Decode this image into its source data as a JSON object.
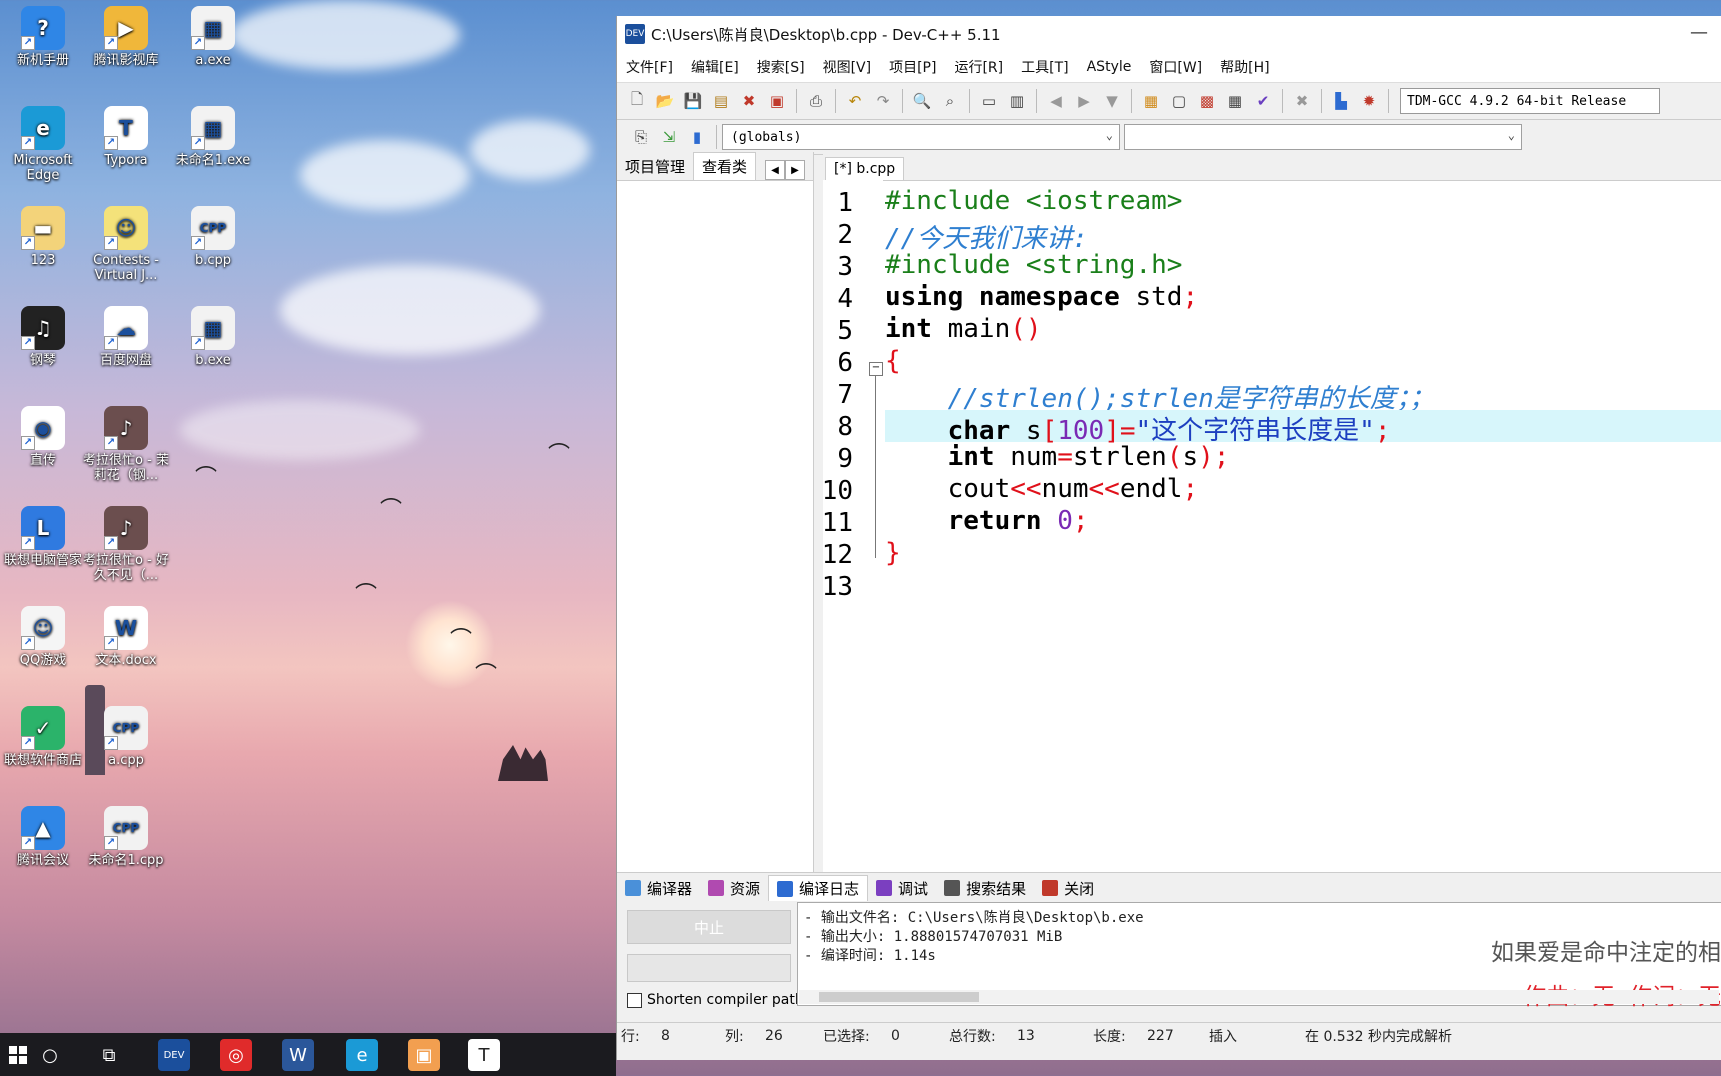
{
  "desktop": {
    "icons": [
      {
        "label": "新机手册",
        "color": "#2f86e6",
        "glyph": "?"
      },
      {
        "label": "腾讯影视库",
        "color": "#f0b73a",
        "glyph": "▶"
      },
      {
        "label": "a.exe",
        "color": "#f2f2f2",
        "glyph": "▦"
      },
      {
        "label": "Microsoft Edge",
        "color": "#1b9ad6",
        "glyph": "e"
      },
      {
        "label": "Typora",
        "color": "#ffffff",
        "glyph": "T"
      },
      {
        "label": "未命名1.exe",
        "color": "#f2f2f2",
        "glyph": "▦"
      },
      {
        "label": "123",
        "color": "#f3d37a",
        "glyph": "▬"
      },
      {
        "label": "Contests - Virtual J...",
        "color": "#f4e27a",
        "glyph": "☺"
      },
      {
        "label": "b.cpp",
        "color": "#f2f2f2",
        "glyph": "CPP"
      },
      {
        "label": "钢琴",
        "color": "#222222",
        "glyph": "♫"
      },
      {
        "label": "百度网盘",
        "color": "#ffffff",
        "glyph": "☁"
      },
      {
        "label": "b.exe",
        "color": "#f2f2f2",
        "glyph": "▦"
      },
      {
        "label": "直传",
        "color": "#ffffff",
        "glyph": "◉"
      },
      {
        "label": "考拉很忙o - 茉莉花（钢...",
        "color": "#6b4e4e",
        "glyph": "♪"
      },
      {
        "label": "联想电脑管家",
        "color": "#2f7ae0",
        "glyph": "L"
      },
      {
        "label": "考拉很忙o - 好久不见（...",
        "color": "#6b4e4e",
        "glyph": "♪"
      },
      {
        "label": "QQ游戏",
        "color": "#f5f5f5",
        "glyph": "☺"
      },
      {
        "label": "文本.docx",
        "color": "#ffffff",
        "glyph": "W"
      },
      {
        "label": "联想软件商店",
        "color": "#2bb36a",
        "glyph": "✓"
      },
      {
        "label": "a.cpp",
        "color": "#f2f2f2",
        "glyph": "CPP"
      },
      {
        "label": "腾讯会议",
        "color": "#2f86e6",
        "glyph": "▲"
      },
      {
        "label": "未命名1.cpp",
        "color": "#f2f2f2",
        "glyph": "CPP"
      }
    ]
  },
  "taskbar": {
    "items": [
      {
        "name": "search-icon",
        "glyph": "○",
        "bg": "transparent"
      },
      {
        "name": "task-view-icon",
        "glyph": "⧉",
        "bg": "transparent"
      },
      {
        "name": "devcpp-taskbar-icon",
        "glyph": "DEV",
        "bg": "#1b4f9c"
      },
      {
        "name": "netease-music-icon",
        "glyph": "◎",
        "bg": "#e02b2b"
      },
      {
        "name": "word-taskbar-icon",
        "glyph": "W",
        "bg": "#2b579a"
      },
      {
        "name": "edge-taskbar-icon",
        "glyph": "e",
        "bg": "#1b9ad6"
      },
      {
        "name": "photos-taskbar-icon",
        "glyph": "▣",
        "bg": "#f29f50"
      },
      {
        "name": "typora-taskbar-icon",
        "glyph": "T",
        "bg": "#ffffff"
      }
    ]
  },
  "window": {
    "title": "C:\\Users\\陈肖良\\Desktop\\b.cpp - Dev-C++ 5.11",
    "app_icon": "DEV",
    "minimize": "—",
    "menu": [
      "文件[F]",
      "编辑[E]",
      "搜索[S]",
      "视图[V]",
      "项目[P]",
      "运行[R]",
      "工具[T]",
      "AStyle",
      "窗口[W]",
      "帮助[H]"
    ],
    "compiler": "TDM-GCC 4.9.2 64-bit Release",
    "scope": "(globals)",
    "scope2": "",
    "left_tabs": [
      "项目管理",
      "查看类"
    ],
    "nav_left": "◀",
    "nav_right": "▶",
    "editor_tab": "[*] b.cpp",
    "fold_marker": "−"
  },
  "code": {
    "current_line": 8,
    "lines": [
      [
        {
          "c": "pp",
          "t": "#include <iostream>"
        }
      ],
      [
        {
          "c": "cm",
          "t": "//今天我们来讲:"
        }
      ],
      [
        {
          "c": "pp",
          "t": "#include <string.h>"
        }
      ],
      [
        {
          "c": "kw",
          "t": "using namespace"
        },
        {
          "c": "tx",
          "t": " std"
        },
        {
          "c": "sym",
          "t": ";"
        }
      ],
      [
        {
          "c": "kw",
          "t": "int"
        },
        {
          "c": "tx",
          "t": " main"
        },
        {
          "c": "sym",
          "t": "()"
        }
      ],
      [
        {
          "c": "sym",
          "t": "{"
        }
      ],
      [
        {
          "c": "tx",
          "t": "    "
        },
        {
          "c": "cm",
          "t": "//strlen();strlen是字符串的长度；；"
        }
      ],
      [
        {
          "c": "tx",
          "t": "    "
        },
        {
          "c": "kw",
          "t": "char"
        },
        {
          "c": "tx",
          "t": " s"
        },
        {
          "c": "sym",
          "t": "["
        },
        {
          "c": "num",
          "t": "100"
        },
        {
          "c": "sym",
          "t": "]="
        },
        {
          "c": "str",
          "t": "\"这个字符串长度是\""
        },
        {
          "c": "sym",
          "t": ";"
        }
      ],
      [
        {
          "c": "tx",
          "t": "    "
        },
        {
          "c": "kw",
          "t": "int"
        },
        {
          "c": "tx",
          "t": " num"
        },
        {
          "c": "sym",
          "t": "="
        },
        {
          "c": "tx",
          "t": "strlen"
        },
        {
          "c": "sym",
          "t": "("
        },
        {
          "c": "tx",
          "t": "s"
        },
        {
          "c": "sym",
          "t": ");"
        }
      ],
      [
        {
          "c": "tx",
          "t": "    cout"
        },
        {
          "c": "sym",
          "t": "<<"
        },
        {
          "c": "tx",
          "t": "num"
        },
        {
          "c": "sym",
          "t": "<<"
        },
        {
          "c": "tx",
          "t": "endl"
        },
        {
          "c": "sym",
          "t": ";"
        }
      ],
      [
        {
          "c": "tx",
          "t": "    "
        },
        {
          "c": "kw",
          "t": "return"
        },
        {
          "c": "tx",
          "t": " "
        },
        {
          "c": "num",
          "t": "0"
        },
        {
          "c": "sym",
          "t": ";"
        }
      ],
      [
        {
          "c": "sym",
          "t": "}"
        }
      ],
      []
    ]
  },
  "bottom": {
    "tabs": [
      {
        "label": "编译器",
        "icon": "compiler-icon",
        "color": "#4a90d9"
      },
      {
        "label": "资源",
        "icon": "resources-icon",
        "color": "#b04ab0"
      },
      {
        "label": "编译日志",
        "icon": "compile-log-icon",
        "color": "#2d6bd1"
      },
      {
        "label": "调试",
        "icon": "debug-icon",
        "color": "#7b3fc0"
      },
      {
        "label": "搜索结果",
        "icon": "search-results-icon",
        "color": "#555555"
      },
      {
        "label": "关闭",
        "icon": "close-icon",
        "color": "#c0392b"
      }
    ],
    "active_tab": 2,
    "stop_label": "中止",
    "shorten_label": "Shorten compiler paths",
    "log": [
      "- 输出文件名: C:\\Users\\陈肖良\\Desktop\\b.exe",
      "- 输出大小: 1.88801574707031 MiB",
      "- 编译时间: 1.14s"
    ],
    "lyrics_line1": "如果爱是命中注定的相",
    "lyrics_line2": "作曲：无  作词：无"
  },
  "status": {
    "line_label": "行:",
    "line": "8",
    "col_label": "列:",
    "col": "26",
    "sel_label": "已选择:",
    "sel": "0",
    "total_label": "总行数:",
    "total": "13",
    "len_label": "长度:",
    "len": "227",
    "mode": "插入",
    "parse": "在 0.532 秒内完成解析"
  }
}
